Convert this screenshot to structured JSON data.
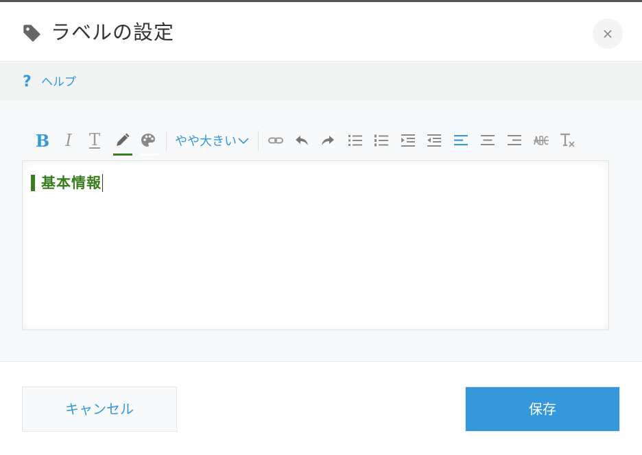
{
  "dialog": {
    "title": "ラベルの設定",
    "close_label": "×",
    "title_icon": "tag-icon"
  },
  "help": {
    "icon": "?",
    "label": "ヘルプ"
  },
  "toolbar": {
    "bold": "B",
    "italic": "I",
    "text_style": "T",
    "font_color_icon": "pencil-icon",
    "bg_color_icon": "palette-icon",
    "font_size": "やや大きい",
    "link_icon": "link-icon",
    "undo_icon": "undo-icon",
    "redo_icon": "redo-icon",
    "bullet_list_icon": "bullet-list-icon",
    "numbered_list_icon": "numbered-list-icon",
    "indent_icon": "indent-icon",
    "outdent_icon": "outdent-icon",
    "align_left_icon": "align-left-icon",
    "align_center_icon": "align-center-icon",
    "align_right_icon": "align-right-icon",
    "strikethrough_icon": "strikethrough-icon",
    "clear_format_icon": "clear-format-icon"
  },
  "editor": {
    "content": "基本情報"
  },
  "footer": {
    "cancel_label": "キャンセル",
    "save_label": "保存"
  },
  "colors": {
    "accent": "#3498db",
    "label_green": "#3a7d1e",
    "icon_gray": "#999999"
  }
}
